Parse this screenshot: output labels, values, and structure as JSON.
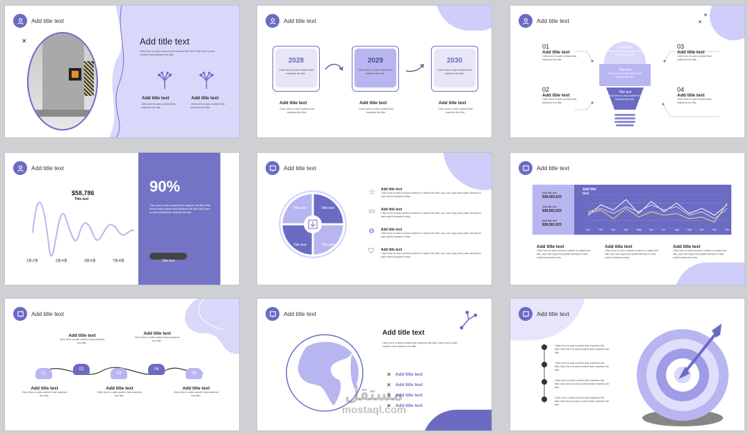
{
  "colors": {
    "accent": "#6b6bc4",
    "light": "#cfcdfa",
    "dark": "#4a4a8c",
    "yellow": "#e8e070"
  },
  "common": {
    "header_title": "Add title text",
    "title_text": "Title text",
    "body_short": "Click here to add content that matches the title.",
    "body_long": "Click here to add content that matches the title,Click here to add content that matches the title."
  },
  "s1": {
    "title": "Add title text",
    "body": "Click here to add content that matches the title.Click here to add content that matches the title.",
    "col_title": "Add title text",
    "col_body": "Click here to add content that matches the title."
  },
  "s2": {
    "years": [
      "2028",
      "2029",
      "2030"
    ],
    "item_title": "Add title text",
    "box_body": "Click here to add content that matches the title.",
    "body": "Click here to add content that matches the title."
  },
  "s3": {
    "numbers": [
      "01",
      "02",
      "03",
      "04"
    ],
    "item_title": "Add title text",
    "body": "Click here to add content that matches the title.",
    "bulb_title": "Title text",
    "bulb_body": "Click here to add content that matches the title."
  },
  "s4": {
    "value": "$58,786",
    "value_label": "Title text",
    "x_ticks": [
      "1월-2월",
      "2월-4월",
      "3월-6월",
      "7월-8월"
    ],
    "percent": "90%",
    "body": "Click here to add content that matches the title,Click here to add content that matches the title,Click here to add content that matches the title.",
    "button": "Title text"
  },
  "s5": {
    "segment_label": "Title text",
    "item_title": "Add title text",
    "item_body": "Click here to add content content to match the title, you can copy and paste directly to add useful keyword entry."
  },
  "s6": {
    "left_items": [
      {
        "label": "Add title text",
        "value": "$38,563,023"
      },
      {
        "label": "Add title text",
        "value": "$38,563,023"
      },
      {
        "label": "Add title text",
        "value": "$38,563,023"
      }
    ],
    "chart_title": "Add title text",
    "months": [
      "Jan",
      "Feb",
      "Mar",
      "Apr",
      "May",
      "Jun",
      "Jul",
      "Aug",
      "Sep",
      "Oct",
      "Nov",
      "Dec"
    ],
    "col_title": "Add title text",
    "col_body": "Click here to add content content to match the title, you can copy and paste directly to add useful keyword entry."
  },
  "s7": {
    "steps": [
      "01",
      "02",
      "03",
      "04",
      "05"
    ],
    "item_title": "Add title text",
    "body": "Click here to add content that matches the title."
  },
  "s8": {
    "title": "Add title text",
    "body": "Click here to add content that matches the title.Click here to add content that matches the title.",
    "list": [
      "Add title text",
      "Add title text",
      "Add title text",
      "Add title text"
    ]
  },
  "s9": {
    "bullets": [
      "Click here to add content that matches the title,Click here to add content that matches the title.",
      "Click here to add content that matches the title,Click here to add content that matches the title.",
      "Click here to add content that matches the title,Click here to add content that matches the title.",
      "Click here to add content that matches the title,Click here to add content that matches the title."
    ]
  },
  "watermark": {
    "arabic": "مستقل",
    "latin": "mostaql.com"
  },
  "chart_data": {
    "type": "line",
    "categories": [
      "Jan",
      "Feb",
      "Mar",
      "Apr",
      "May",
      "Jun",
      "Jul",
      "Aug",
      "Sep",
      "Oct",
      "Nov",
      "Dec"
    ],
    "series": [
      {
        "values": [
          40,
          70,
          55,
          85,
          45,
          80,
          50,
          75,
          45,
          60,
          40,
          70
        ]
      },
      {
        "values": [
          50,
          60,
          45,
          65,
          50,
          70,
          55,
          65,
          40,
          50,
          30,
          60
        ]
      },
      {
        "values": [
          45,
          55,
          30,
          60,
          35,
          50,
          40,
          45,
          30,
          35,
          20,
          75
        ]
      }
    ]
  }
}
